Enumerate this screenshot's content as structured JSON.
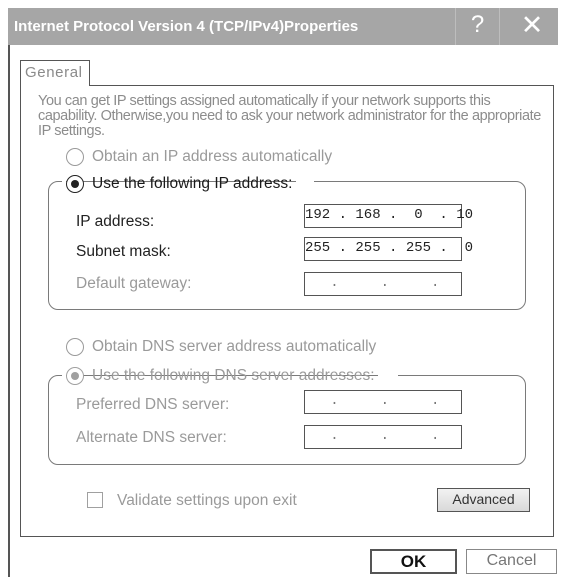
{
  "window": {
    "title": "Internet Protocol Version 4 (TCP/IPv4)Properties",
    "help_glyph": "?",
    "close_glyph": "✕"
  },
  "tabs": [
    {
      "label": "General",
      "selected": true
    }
  ],
  "description": "You can get IP settings assigned automatically if your network supports this capability. Otherwise,you need to ask your network administrator for the appropriate IP settings.",
  "ip_section": {
    "auto_label": "Obtain an IP address automatically",
    "auto_selected": false,
    "manual_label": "Use the following IP address:",
    "manual_selected": true,
    "fields": {
      "ip_address": {
        "label": "IP address:",
        "value": "192 . 168 .  0  . 10"
      },
      "subnet_mask": {
        "label": "Subnet mask:",
        "value": "255 . 255 . 255 .  0"
      },
      "default_gateway": {
        "label": "Default gateway:",
        "value": "   .     .     .   "
      }
    }
  },
  "dns_section": {
    "auto_label": "Obtain DNS  server address automatically",
    "auto_selected": false,
    "manual_label": "Use the following DNS server addresses:",
    "manual_selected": true,
    "fields": {
      "preferred": {
        "label": "Preferred DNS server:",
        "value": "   .     .     .   "
      },
      "alternate": {
        "label": "Alternate DNS server:",
        "value": "   .     .     .   "
      }
    }
  },
  "validate": {
    "label": "Validate settings upon exit",
    "checked": false
  },
  "buttons": {
    "advanced": "Advanced",
    "ok": "OK",
    "cancel": "Cancel"
  },
  "colors": {
    "titlebar": "#a6a6a6",
    "title_text": "#ffffff",
    "disabled_text": "#9a9a9a",
    "border": "#555555"
  }
}
